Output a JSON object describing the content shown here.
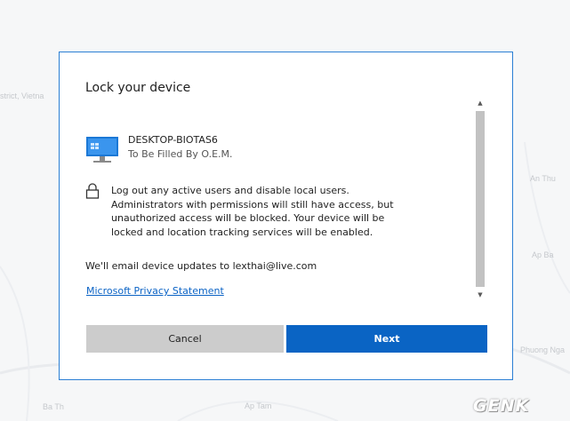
{
  "background": {
    "map_labels": [
      "strict, Vietna",
      "An Thu",
      "Ba Th",
      "Ap Tam",
      "Phuong Nga",
      "Ap Ba"
    ]
  },
  "dialog": {
    "title": "Lock your device",
    "device": {
      "name": "DESKTOP-BIOTAS6",
      "manufacturer": "To Be Filled By O.E.M."
    },
    "lock_description": "Log out any active users and disable local users. Administrators with permissions will still have access, but unauthorized access will be blocked. Your device will be locked and location tracking services will be enabled.",
    "email_notice": "We'll email device updates to lexthai@live.com",
    "privacy_link": "Microsoft Privacy Statement",
    "buttons": {
      "cancel": "Cancel",
      "next": "Next"
    }
  },
  "watermark": "GENK",
  "colors": {
    "accent": "#0a64c4",
    "dialog_border": "#2b7fd4",
    "cancel_bg": "#cccccc",
    "link": "#0b63c5"
  },
  "icons": {
    "device": "monitor-icon",
    "lock": "lock-icon",
    "scroll_up": "scroll-up-arrow-icon",
    "scroll_down": "scroll-down-arrow-icon"
  }
}
